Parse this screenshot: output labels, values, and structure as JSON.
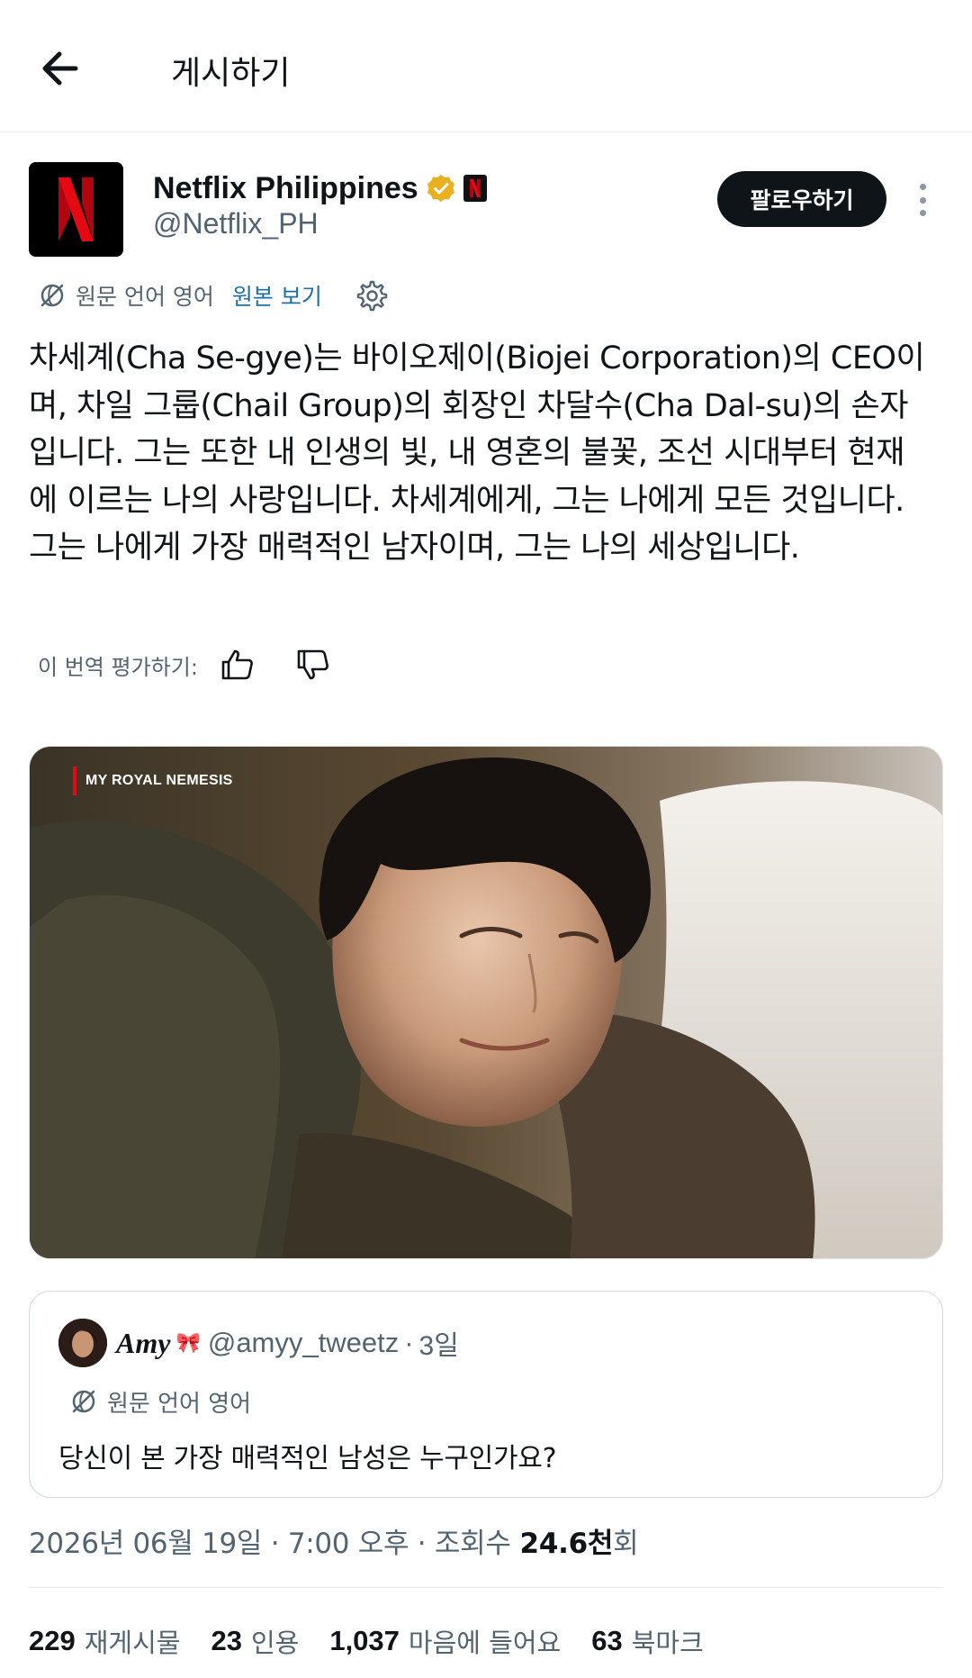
{
  "header": {
    "title": "게시하기"
  },
  "author": {
    "name": "Netflix Philippines",
    "handle": "@Netflix_PH",
    "follow_label": "팔로우하기",
    "brand_color": "#e50914",
    "verified_color": "#e9b01f"
  },
  "translation": {
    "source_label": "원문 언어 영어",
    "show_original": "원본 보기",
    "rate_label": "이 번역 평가하기:"
  },
  "post": {
    "text": "차세계(Cha Se-gye)는 바이오제이(Biojei Corporation)의 CEO이며, 차일 그룹(Chail Group)의 회장인 차달수(Cha Dal-su)의 손자입니다. 그는 또한 내 인생의 빛, 내 영혼의 불꽃, 조선 시대부터 현재에 이르는 나의 사랑입니다. 차세계에게, 그는 나에게 모든 것입니다. 그는 나에게 가장 매력적인 남자이며, 그는 나의 세상입니다."
  },
  "media": {
    "label": "MY ROYAL NEMESIS"
  },
  "quote": {
    "name": "Amy",
    "bow": "🎀",
    "handle": "@amyy_tweetz",
    "separator": "·",
    "time": "3일",
    "translate_label": "원문 언어 영어",
    "text": "당신이 본 가장 매력적인 남성은 누구인가요?"
  },
  "meta": {
    "timestamp": "2026년 06월 19일 · 7:00 오후 · 조회수",
    "views_number": "24.6천",
    "views_suffix": "회"
  },
  "stats": {
    "reposts_num": "229",
    "reposts_label": "재게시물",
    "quotes_num": "23",
    "quotes_label": "인용",
    "likes_num": "1,037",
    "likes_label": "마음에 들어요",
    "bookmarks_num": "63",
    "bookmarks_label": "북마크"
  }
}
